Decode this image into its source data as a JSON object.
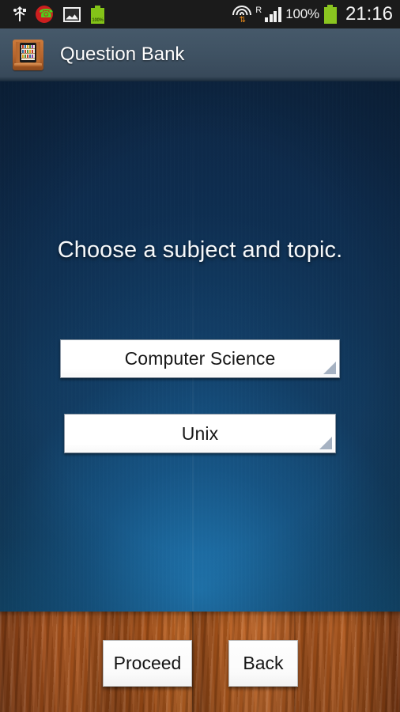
{
  "status_bar": {
    "icons_left": [
      {
        "name": "usb-icon",
        "label": "USB connected"
      },
      {
        "name": "missed-call-icon",
        "label": "Missed call"
      },
      {
        "name": "screenshot-image-icon",
        "label": "Screenshot captured"
      },
      {
        "name": "battery-small-icon",
        "label": "100%"
      }
    ],
    "battery_small_percent": "100%",
    "wifi_icon": "wifi-icon",
    "roaming_indicator": "R",
    "signal_icon": "cellular-signal-icon",
    "battery_percent": "100%",
    "battery_icon": "battery-icon",
    "clock": "21:16"
  },
  "title_bar": {
    "app_icon": "question-bank-app-icon",
    "title": "Question Bank"
  },
  "main": {
    "headline": "Choose a subject and topic.",
    "spinners": [
      {
        "name": "subject-spinner",
        "value": "Computer Science",
        "dropdown_icon": "spinner-triangle-icon"
      },
      {
        "name": "topic-spinner",
        "value": "Unix",
        "dropdown_icon": "spinner-triangle-icon"
      }
    ]
  },
  "footer": {
    "buttons": [
      {
        "name": "proceed-button",
        "label": "Proceed"
      },
      {
        "name": "back-button",
        "label": "Back"
      }
    ]
  },
  "colors": {
    "status_bar_bg": "#1b1b1b",
    "title_bar_bg": "#3f5263",
    "wall_dark": "#0d2643",
    "wall_light": "#15679b",
    "floor_wood": "#a8511a",
    "battery_green": "#84c318",
    "accent_text": "#ffffff"
  }
}
